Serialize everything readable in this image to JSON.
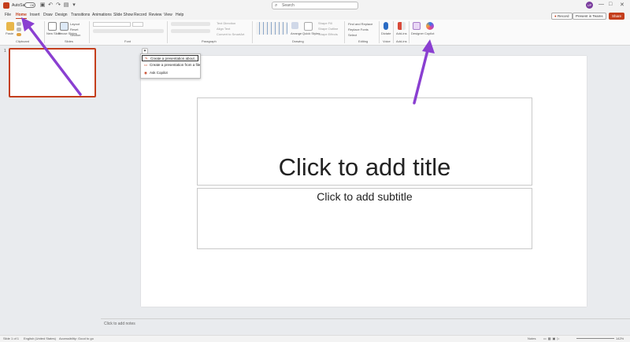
{
  "titlebar": {
    "autosave_label": "AutoSave",
    "autosave_state": "Off",
    "search_placeholder": "Search",
    "avatar_initials": "UP",
    "window_controls": [
      "—",
      "□",
      "✕"
    ]
  },
  "tabs": [
    "File",
    "Home",
    "Insert",
    "Draw",
    "Design",
    "Transitions",
    "Animations",
    "Slide Show",
    "Record",
    "Review",
    "View",
    "Help"
  ],
  "active_tab": "Home",
  "tab_actions": {
    "record": "Record",
    "present_teams": "Present in Teams",
    "share": "Share"
  },
  "ribbon": {
    "clipboard_paste": "Paste",
    "group_clipboard": "Clipboard",
    "new_slide": "New Slide",
    "reuse_slides": "Reuse Slides",
    "layout": "Layout",
    "reset": "Reset",
    "section": "Section",
    "group_slides": "Slides",
    "group_font": "Font",
    "group_paragraph": "Paragraph",
    "arrange": "Arrange",
    "quick_styles": "Quick Styles",
    "group_drawing": "Drawing",
    "find_replace": "Find and Replace",
    "replace_fonts": "Replace Fonts",
    "select": "Select",
    "group_editing": "Editing",
    "dictate": "Dictate",
    "group_voice": "Voice",
    "addins": "Add-ins",
    "group_addins": "Add-ins",
    "designer": "Designer",
    "copilot": "Copilot",
    "text_direction": "Text Direction",
    "align_text": "Align Text",
    "convert_smartart": "Convert to SmartArt",
    "shape_fill": "Shape Fill",
    "shape_outline": "Shape Outline",
    "shape_effects": "Shape Effects"
  },
  "copilot_menu": {
    "items": [
      "Create a presentation about...",
      "Create a presentation from a file",
      "Ask Copilot"
    ]
  },
  "thumbnails": {
    "slide_number": "1"
  },
  "slide": {
    "title_placeholder": "Click to add title",
    "subtitle_placeholder": "Click to add subtitle"
  },
  "notes_placeholder": "Click to add notes",
  "status": {
    "slide_count": "Slide 1 of 1",
    "language": "English (United States)",
    "accessibility": "Accessibility: Good to go",
    "notes": "Notes",
    "zoom": "142%"
  },
  "colors": {
    "accent": "#c43e1c",
    "annotation_arrow": "#8a3fd1"
  }
}
